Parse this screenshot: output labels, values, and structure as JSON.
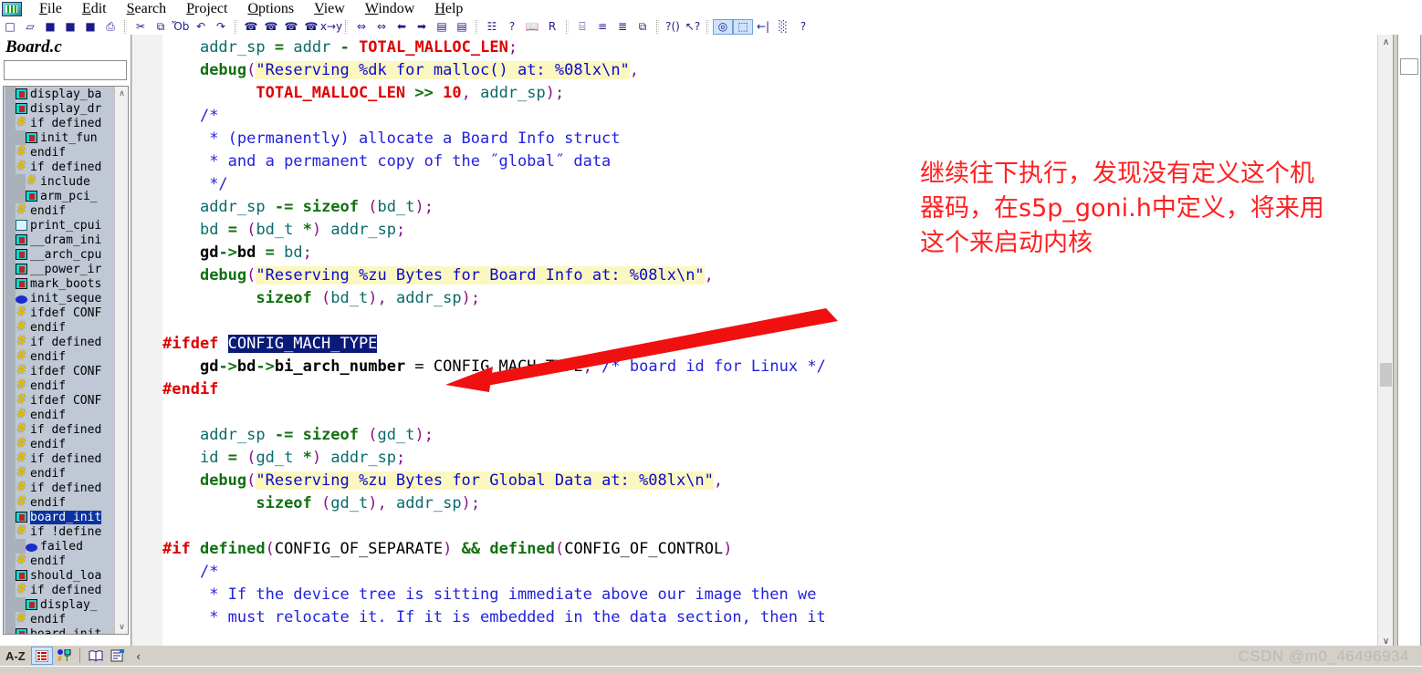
{
  "app": {
    "title": "Source Insight",
    "watermark": "CSDN @m0_46496934"
  },
  "menubar": {
    "logo_name": "app-logo",
    "items": [
      {
        "label": "File",
        "hotkey": "F"
      },
      {
        "label": "Edit",
        "hotkey": "E"
      },
      {
        "label": "Search",
        "hotkey": "S"
      },
      {
        "label": "Project",
        "hotkey": "P"
      },
      {
        "label": "Options",
        "hotkey": "O"
      },
      {
        "label": "View",
        "hotkey": "V"
      },
      {
        "label": "Window",
        "hotkey": "W"
      },
      {
        "label": "Help",
        "hotkey": "H"
      }
    ]
  },
  "toolbar": {
    "groups": [
      {
        "buttons": [
          {
            "name": "new-file-icon",
            "glyph": "□"
          },
          {
            "name": "open-file-icon",
            "glyph": "▱"
          },
          {
            "name": "save-file-icon",
            "glyph": "■"
          },
          {
            "name": "save-as-icon",
            "glyph": "■"
          },
          {
            "name": "save-all-icon",
            "glyph": "■"
          },
          {
            "name": "print-icon",
            "glyph": "⎙"
          }
        ]
      },
      {
        "buttons": [
          {
            "name": "cut-icon",
            "glyph": "✂"
          },
          {
            "name": "copy-icon",
            "glyph": "⧉"
          },
          {
            "name": "paste-icon",
            "glyph": "Ὄb"
          },
          {
            "name": "undo-icon",
            "glyph": "↶"
          },
          {
            "name": "redo-icon",
            "glyph": "↷"
          }
        ]
      },
      {
        "buttons": [
          {
            "name": "search-icon",
            "glyph": "☎"
          },
          {
            "name": "search-backward-icon",
            "glyph": "☎"
          },
          {
            "name": "search-forward-icon",
            "glyph": "☎"
          },
          {
            "name": "search-files-icon",
            "glyph": "☎"
          },
          {
            "name": "replace-icon",
            "glyph": "x→y"
          }
        ]
      },
      {
        "buttons": [
          {
            "name": "jump-to-definition-icon",
            "glyph": "⇔"
          },
          {
            "name": "jump-back-icon",
            "glyph": "⇔"
          },
          {
            "name": "back-icon",
            "glyph": "⬅"
          },
          {
            "name": "forward-icon",
            "glyph": "➡"
          },
          {
            "name": "goto-line-icon",
            "glyph": "▤"
          },
          {
            "name": "bookmark-icon",
            "glyph": "▤"
          }
        ]
      },
      {
        "buttons": [
          {
            "name": "browse-project-symbols-icon",
            "glyph": "☷"
          },
          {
            "name": "context-help-icon",
            "glyph": "?"
          },
          {
            "name": "reference-icon",
            "glyph": "📖"
          },
          {
            "name": "relation-window-icon",
            "glyph": "R"
          }
        ]
      },
      {
        "buttons": [
          {
            "name": "tile-windows-icon",
            "glyph": "⌸"
          },
          {
            "name": "tile-horizontal-icon",
            "glyph": "≡"
          },
          {
            "name": "tile-vertical-icon",
            "glyph": "≣"
          },
          {
            "name": "cascade-windows-icon",
            "glyph": "⧉"
          }
        ]
      },
      {
        "buttons": [
          {
            "name": "symbol-info-icon",
            "glyph": "?()"
          },
          {
            "name": "smart-rename-icon",
            "glyph": "↖?"
          }
        ]
      },
      {
        "buttons": [
          {
            "name": "highlight-word-icon",
            "glyph": "◎",
            "highlighted": true
          },
          {
            "name": "select-block-icon",
            "glyph": "⬚",
            "highlighted": true
          },
          {
            "name": "indent-icon",
            "glyph": "←|"
          },
          {
            "name": "comment-block-icon",
            "glyph": "░"
          },
          {
            "name": "about-icon",
            "glyph": "?"
          }
        ]
      }
    ]
  },
  "sidebar": {
    "file_title": "Board.c",
    "search_value": "",
    "search_placeholder": "",
    "scroll_up_glyph": "∧",
    "scroll_down_glyph": "∨",
    "tree": [
      {
        "icon": "function",
        "indent": 1,
        "label": "display_ba"
      },
      {
        "icon": "function",
        "indent": 1,
        "label": "display_dr"
      },
      {
        "icon": "preproc",
        "indent": 1,
        "label": "if defined"
      },
      {
        "icon": "function",
        "indent": 2,
        "label": "init_fun"
      },
      {
        "icon": "preproc",
        "indent": 1,
        "label": "endif"
      },
      {
        "icon": "preproc",
        "indent": 1,
        "label": "if defined"
      },
      {
        "icon": "preproc",
        "indent": 2,
        "label": "include"
      },
      {
        "icon": "function",
        "indent": 2,
        "label": "arm_pci_"
      },
      {
        "icon": "preproc",
        "indent": 1,
        "label": "endif"
      },
      {
        "icon": "doc",
        "indent": 1,
        "label": "print_cpui"
      },
      {
        "icon": "function",
        "indent": 1,
        "label": "__dram_ini"
      },
      {
        "icon": "function",
        "indent": 1,
        "label": "__arch_cpu"
      },
      {
        "icon": "function",
        "indent": 1,
        "label": "__power_ir"
      },
      {
        "icon": "function",
        "indent": 1,
        "label": "mark_boots"
      },
      {
        "icon": "oval",
        "indent": 1,
        "label": "init_seque"
      },
      {
        "icon": "preproc",
        "indent": 1,
        "label": "ifdef CONF"
      },
      {
        "icon": "preproc",
        "indent": 1,
        "label": "endif"
      },
      {
        "icon": "preproc",
        "indent": 1,
        "label": "if defined"
      },
      {
        "icon": "preproc",
        "indent": 1,
        "label": "endif"
      },
      {
        "icon": "preproc",
        "indent": 1,
        "label": "ifdef CONF"
      },
      {
        "icon": "preproc",
        "indent": 1,
        "label": "endif"
      },
      {
        "icon": "preproc",
        "indent": 1,
        "label": "ifdef CONF"
      },
      {
        "icon": "preproc",
        "indent": 1,
        "label": "endif"
      },
      {
        "icon": "preproc",
        "indent": 1,
        "label": "if defined"
      },
      {
        "icon": "preproc",
        "indent": 1,
        "label": "endif"
      },
      {
        "icon": "preproc",
        "indent": 1,
        "label": "if defined"
      },
      {
        "icon": "preproc",
        "indent": 1,
        "label": "endif"
      },
      {
        "icon": "preproc",
        "indent": 1,
        "label": "if defined"
      },
      {
        "icon": "preproc",
        "indent": 1,
        "label": "endif"
      },
      {
        "icon": "function",
        "indent": 1,
        "label": "board_init",
        "selected": true
      },
      {
        "icon": "preproc",
        "indent": 1,
        "label": "if !define"
      },
      {
        "icon": "oval",
        "indent": 2,
        "label": "failed"
      },
      {
        "icon": "preproc",
        "indent": 1,
        "label": "endif"
      },
      {
        "icon": "function",
        "indent": 1,
        "label": "should_loa"
      },
      {
        "icon": "preproc",
        "indent": 1,
        "label": "if defined"
      },
      {
        "icon": "function",
        "indent": 2,
        "label": "display_"
      },
      {
        "icon": "preproc",
        "indent": 1,
        "label": "endif"
      },
      {
        "icon": "function",
        "indent": 1,
        "label": "board_init"
      }
    ]
  },
  "editor": {
    "scroll_up_glyph": "∧",
    "scroll_down_glyph": "∨",
    "lines": [
      [
        {
          "t": "plain",
          "s": "    "
        },
        {
          "t": "id",
          "s": "addr_sp"
        },
        {
          "t": "plain",
          "s": " "
        },
        {
          "t": "op",
          "s": "="
        },
        {
          "t": "plain",
          "s": " "
        },
        {
          "t": "id",
          "s": "addr"
        },
        {
          "t": "plain",
          "s": " "
        },
        {
          "t": "op",
          "s": "-"
        },
        {
          "t": "plain",
          "s": " "
        },
        {
          "t": "macro",
          "s": "TOTAL_MALLOC_LEN"
        },
        {
          "t": "punc",
          "s": ";"
        }
      ],
      [
        {
          "t": "plain",
          "s": "    "
        },
        {
          "t": "fn",
          "s": "debug"
        },
        {
          "t": "punc",
          "s": "("
        },
        {
          "t": "str",
          "s": "\"Reserving %dk for malloc() at: %08lx\\n\""
        },
        {
          "t": "punc",
          "s": ","
        }
      ],
      [
        {
          "t": "plain",
          "s": "          "
        },
        {
          "t": "macro",
          "s": "TOTAL_MALLOC_LEN"
        },
        {
          "t": "plain",
          "s": " "
        },
        {
          "t": "op",
          "s": ">>"
        },
        {
          "t": "plain",
          "s": " "
        },
        {
          "t": "num",
          "s": "10"
        },
        {
          "t": "punc",
          "s": ","
        },
        {
          "t": "plain",
          "s": " "
        },
        {
          "t": "id",
          "s": "addr_sp"
        },
        {
          "t": "punc",
          "s": ");"
        }
      ],
      [
        {
          "t": "plain",
          "s": "    "
        },
        {
          "t": "cmt",
          "s": "/*"
        }
      ],
      [
        {
          "t": "plain",
          "s": "     "
        },
        {
          "t": "cmt",
          "s": "* (permanently) allocate a Board Info struct"
        }
      ],
      [
        {
          "t": "plain",
          "s": "     "
        },
        {
          "t": "cmt",
          "s": "* and a permanent copy of the ˝global˝ data"
        }
      ],
      [
        {
          "t": "plain",
          "s": "     "
        },
        {
          "t": "cmt",
          "s": "*/"
        }
      ],
      [
        {
          "t": "plain",
          "s": "    "
        },
        {
          "t": "id",
          "s": "addr_sp"
        },
        {
          "t": "plain",
          "s": " "
        },
        {
          "t": "op",
          "s": "-="
        },
        {
          "t": "plain",
          "s": " "
        },
        {
          "t": "kw",
          "s": "sizeof"
        },
        {
          "t": "plain",
          "s": " "
        },
        {
          "t": "punc",
          "s": "("
        },
        {
          "t": "id",
          "s": "bd_t"
        },
        {
          "t": "punc",
          "s": ");"
        }
      ],
      [
        {
          "t": "plain",
          "s": "    "
        },
        {
          "t": "id",
          "s": "bd"
        },
        {
          "t": "plain",
          "s": " "
        },
        {
          "t": "op",
          "s": "="
        },
        {
          "t": "plain",
          "s": " "
        },
        {
          "t": "punc",
          "s": "("
        },
        {
          "t": "id",
          "s": "bd_t"
        },
        {
          "t": "plain",
          "s": " "
        },
        {
          "t": "op",
          "s": "*"
        },
        {
          "t": "punc",
          "s": ")"
        },
        {
          "t": "plain",
          "s": " "
        },
        {
          "t": "id",
          "s": "addr_sp"
        },
        {
          "t": "punc",
          "s": ";"
        }
      ],
      [
        {
          "t": "plain",
          "s": "    "
        },
        {
          "t": "bold",
          "s": "gd"
        },
        {
          "t": "op",
          "s": "->"
        },
        {
          "t": "bold",
          "s": "bd"
        },
        {
          "t": "plain",
          "s": " "
        },
        {
          "t": "op",
          "s": "="
        },
        {
          "t": "plain",
          "s": " "
        },
        {
          "t": "id",
          "s": "bd"
        },
        {
          "t": "punc",
          "s": ";"
        }
      ],
      [
        {
          "t": "plain",
          "s": "    "
        },
        {
          "t": "fn",
          "s": "debug"
        },
        {
          "t": "punc",
          "s": "("
        },
        {
          "t": "str",
          "s": "\"Reserving %zu Bytes for Board Info at: %08lx\\n\""
        },
        {
          "t": "punc",
          "s": ","
        }
      ],
      [
        {
          "t": "plain",
          "s": "          "
        },
        {
          "t": "kw",
          "s": "sizeof"
        },
        {
          "t": "plain",
          "s": " "
        },
        {
          "t": "punc",
          "s": "("
        },
        {
          "t": "id",
          "s": "bd_t"
        },
        {
          "t": "punc",
          "s": "),"
        },
        {
          "t": "plain",
          "s": " "
        },
        {
          "t": "id",
          "s": "addr_sp"
        },
        {
          "t": "punc",
          "s": ");"
        }
      ],
      [],
      [
        {
          "t": "pp",
          "s": "#ifdef "
        },
        {
          "t": "sel",
          "s": "CONFIG_MACH_TYPE"
        }
      ],
      [
        {
          "t": "plain",
          "s": "    "
        },
        {
          "t": "bold",
          "s": "gd"
        },
        {
          "t": "op",
          "s": "->"
        },
        {
          "t": "bold",
          "s": "bd"
        },
        {
          "t": "op",
          "s": "->"
        },
        {
          "t": "bold",
          "s": "bi_arch_number"
        },
        {
          "t": "plain",
          "s": " = "
        },
        {
          "t": "plain",
          "s": "CONFIG_MACH_TYPE"
        },
        {
          "t": "punc",
          "s": ";"
        },
        {
          "t": "plain",
          "s": " "
        },
        {
          "t": "cmt",
          "s": "/* board id for Linux */"
        }
      ],
      [
        {
          "t": "pp",
          "s": "#endif"
        }
      ],
      [],
      [
        {
          "t": "plain",
          "s": "    "
        },
        {
          "t": "id",
          "s": "addr_sp"
        },
        {
          "t": "plain",
          "s": " "
        },
        {
          "t": "op",
          "s": "-="
        },
        {
          "t": "plain",
          "s": " "
        },
        {
          "t": "kw",
          "s": "sizeof"
        },
        {
          "t": "plain",
          "s": " "
        },
        {
          "t": "punc",
          "s": "("
        },
        {
          "t": "id",
          "s": "gd_t"
        },
        {
          "t": "punc",
          "s": ");"
        }
      ],
      [
        {
          "t": "plain",
          "s": "    "
        },
        {
          "t": "id",
          "s": "id"
        },
        {
          "t": "plain",
          "s": " "
        },
        {
          "t": "op",
          "s": "="
        },
        {
          "t": "plain",
          "s": " "
        },
        {
          "t": "punc",
          "s": "("
        },
        {
          "t": "id",
          "s": "gd_t"
        },
        {
          "t": "plain",
          "s": " "
        },
        {
          "t": "op",
          "s": "*"
        },
        {
          "t": "punc",
          "s": ")"
        },
        {
          "t": "plain",
          "s": " "
        },
        {
          "t": "id",
          "s": "addr_sp"
        },
        {
          "t": "punc",
          "s": ";"
        }
      ],
      [
        {
          "t": "plain",
          "s": "    "
        },
        {
          "t": "fn",
          "s": "debug"
        },
        {
          "t": "punc",
          "s": "("
        },
        {
          "t": "str",
          "s": "\"Reserving %zu Bytes for Global Data at: %08lx\\n\""
        },
        {
          "t": "punc",
          "s": ","
        }
      ],
      [
        {
          "t": "plain",
          "s": "          "
        },
        {
          "t": "kw",
          "s": "sizeof"
        },
        {
          "t": "plain",
          "s": " "
        },
        {
          "t": "punc",
          "s": "("
        },
        {
          "t": "id",
          "s": "gd_t"
        },
        {
          "t": "punc",
          "s": "),"
        },
        {
          "t": "plain",
          "s": " "
        },
        {
          "t": "id",
          "s": "addr_sp"
        },
        {
          "t": "punc",
          "s": ");"
        }
      ],
      [],
      [
        {
          "t": "pp",
          "s": "#if "
        },
        {
          "t": "kw",
          "s": "defined"
        },
        {
          "t": "punc",
          "s": "("
        },
        {
          "t": "plain",
          "s": "CONFIG_OF_SEPARATE"
        },
        {
          "t": "punc",
          "s": ")"
        },
        {
          "t": "plain",
          "s": " "
        },
        {
          "t": "op",
          "s": "&&"
        },
        {
          "t": "plain",
          "s": " "
        },
        {
          "t": "kw",
          "s": "defined"
        },
        {
          "t": "punc",
          "s": "("
        },
        {
          "t": "plain",
          "s": "CONFIG_OF_CONTROL"
        },
        {
          "t": "punc",
          "s": ")"
        }
      ],
      [
        {
          "t": "plain",
          "s": "    "
        },
        {
          "t": "cmt",
          "s": "/*"
        }
      ],
      [
        {
          "t": "plain",
          "s": "     "
        },
        {
          "t": "cmt",
          "s": "* If the device tree is sitting immediate above our image then we"
        }
      ],
      [
        {
          "t": "plain",
          "s": "     "
        },
        {
          "t": "cmt",
          "s": "* must relocate it. If it is embedded in the data section, then it"
        }
      ]
    ]
  },
  "annotation": {
    "text": "继续往下执行，发现没有定义这个机\n器码，在s5p_goni.h中定义，将来用\n这个来启动内核",
    "color": "#ff1f1f",
    "arrow_color": "#f01010"
  },
  "bottom_toolbar": {
    "sort_label": "A-Z",
    "buttons": [
      {
        "name": "sort-alphabetical-button",
        "glyph": "A-Z",
        "is_label": true
      },
      {
        "name": "outline-view-button",
        "glyph": "☰",
        "highlighted": true
      },
      {
        "name": "symbol-types-button",
        "glyph": "⚇"
      },
      {
        "name": "reference-book-button",
        "glyph": "📖"
      },
      {
        "name": "properties-button",
        "glyph": "☰"
      }
    ],
    "collapse_glyph": "‹"
  }
}
